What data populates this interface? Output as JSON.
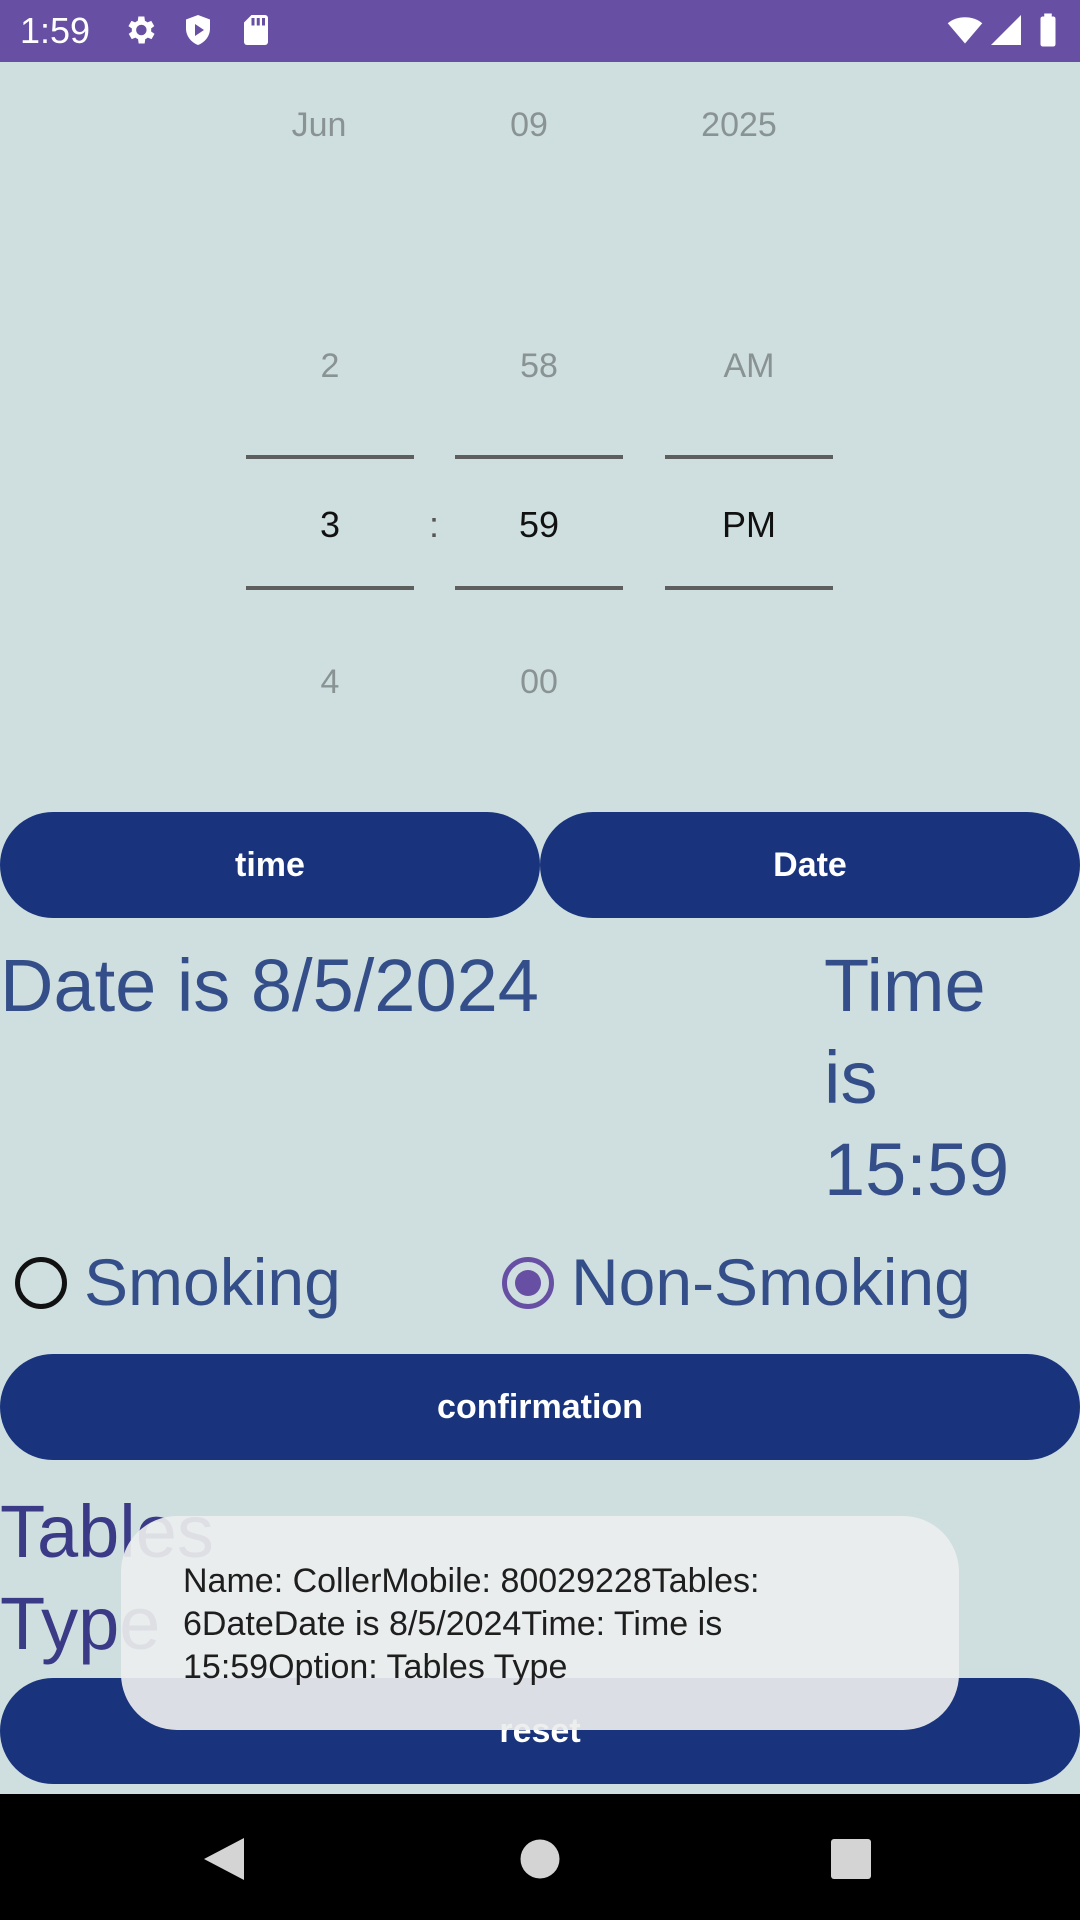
{
  "status_bar": {
    "time": "1:59",
    "icons": [
      "gear-icon",
      "shield-icon",
      "sd-card-icon",
      "wifi-icon",
      "signal-icon",
      "battery-icon"
    ]
  },
  "date_picker": {
    "month": "Jun",
    "day": "09",
    "year": "2025"
  },
  "time_picker": {
    "hour_prev": "2",
    "minute_prev": "58",
    "ampm_prev": "AM",
    "hour": "3",
    "separator": ":",
    "minute": "59",
    "ampm": "PM",
    "hour_next": "4",
    "minute_next": "00"
  },
  "buttons": {
    "time": "time",
    "date": "Date",
    "confirmation": "confirmation",
    "reset": "reset"
  },
  "date_text": "Date is 8/5/2024",
  "time_text": {
    "line1": "Time",
    "line2": "is",
    "line3": "15:59"
  },
  "options": {
    "smoking": "Smoking",
    "non_smoking": "Non-Smoking",
    "selected": "non_smoking"
  },
  "tables_type": {
    "line1": "Tables",
    "line2": "Type"
  },
  "toast": {
    "line1": "Name: CollerMobile: 80029228Tables:",
    "line2": "6DateDate is 8/5/2024Time: Time is",
    "line3": "15:59Option: Tables Type"
  },
  "colors": {
    "status_bar": "#6750a4",
    "background": "#cfdfdf",
    "button": "#19347c",
    "text": "#344e89",
    "radio_selected": "#6750a4"
  }
}
